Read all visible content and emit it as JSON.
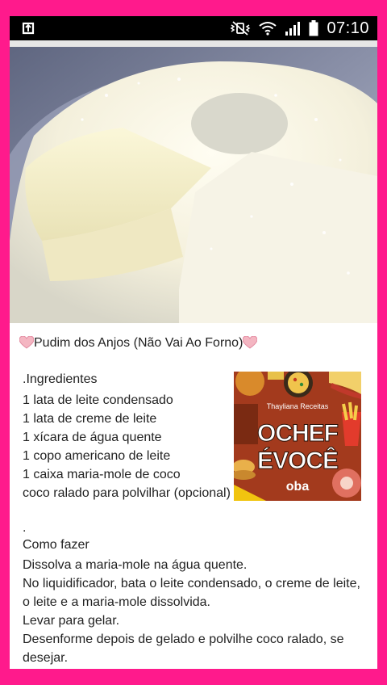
{
  "status_bar": {
    "time": "07:10",
    "icons": [
      "app-notification-icon",
      "mute-vibrate-icon",
      "wifi-icon",
      "signal-icon",
      "battery-icon"
    ]
  },
  "recipe": {
    "title": "Pudim dos Anjos (Não Vai Ao Forno)",
    "ingredients_header": ".Ingredientes",
    "ingredients": [
      "1 lata de leite condensado",
      "1 lata de creme de leite",
      "1 xícara de água quente",
      "1 copo americano de leite",
      "1 caixa maria-mole de coco",
      "coco ralado para polvilhar (opcional)"
    ],
    "separator": ".",
    "method_header": "Como fazer",
    "steps": [
      "Dissolva a maria-mole na água quente.",
      "No liquidificador, bata o leite condensado, o creme de leite, o leite e a maria-mole dissolvida.",
      "Levar para gelar.",
      "Desenforme depois de gelado e polvilhe coco ralado, se desejar."
    ]
  },
  "logo": {
    "credit": "Thayliana Receitas",
    "line1": "OCHEF",
    "line2": "ÉVOCÊ",
    "brand": "oba"
  },
  "colors": {
    "frame": "#ff1a8c",
    "heart": "#f4b6c2",
    "logo_text": "#ffffff"
  }
}
